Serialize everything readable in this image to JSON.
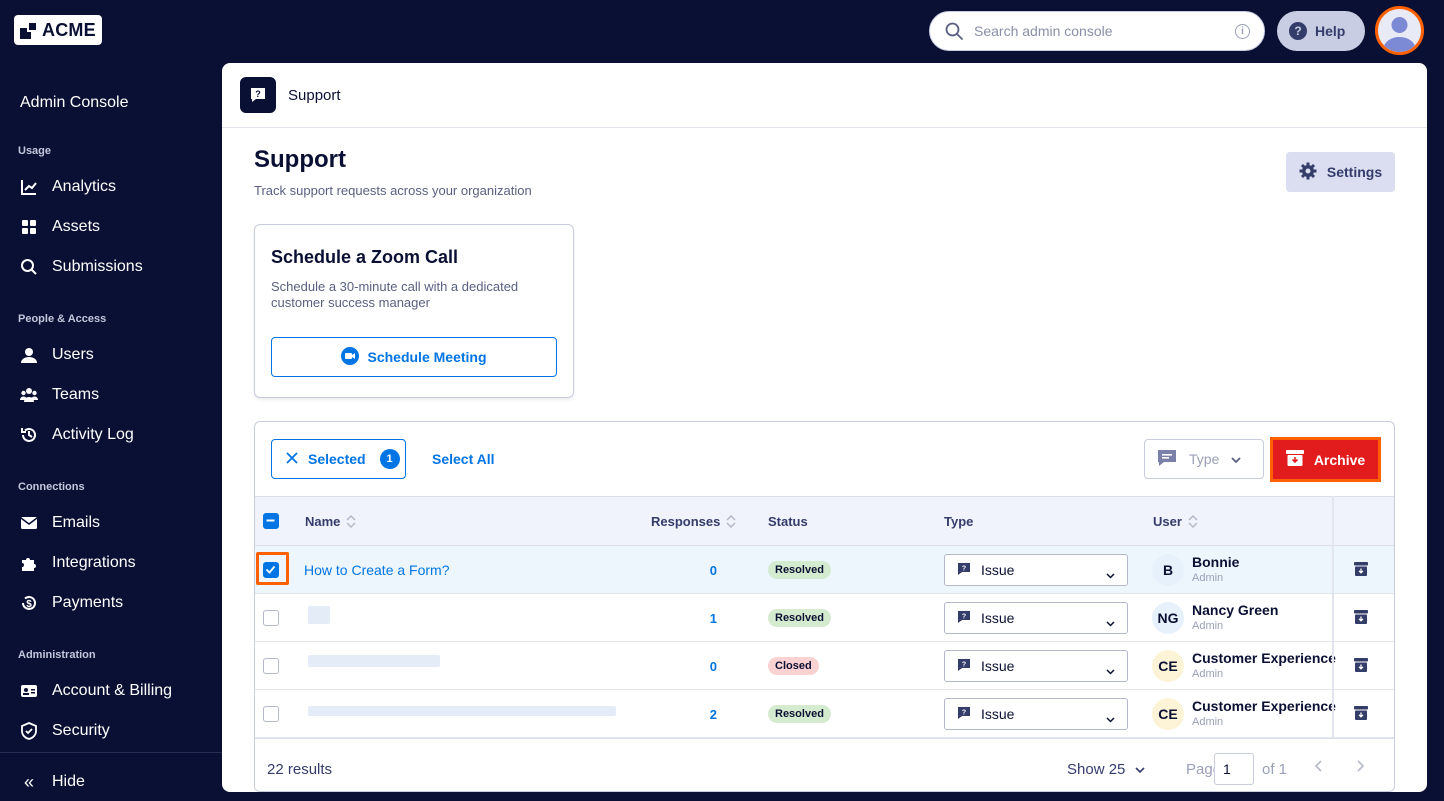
{
  "topbar": {
    "logo_text": "ACME",
    "search_placeholder": "Search admin console",
    "help_label": "Help"
  },
  "sidebar": {
    "title": "Admin Console",
    "sections": [
      {
        "label": "Usage",
        "items": [
          {
            "label": "Analytics",
            "icon": "chart-line-icon"
          },
          {
            "label": "Assets",
            "icon": "assets-grid-icon"
          },
          {
            "label": "Submissions",
            "icon": "search-icon"
          }
        ]
      },
      {
        "label": "People & Access",
        "items": [
          {
            "label": "Users",
            "icon": "user-icon"
          },
          {
            "label": "Teams",
            "icon": "team-icon"
          },
          {
            "label": "Activity Log",
            "icon": "history-icon"
          }
        ]
      },
      {
        "label": "Connections",
        "items": [
          {
            "label": "Emails",
            "icon": "envelope-icon"
          },
          {
            "label": "Integrations",
            "icon": "puzzle-icon"
          },
          {
            "label": "Payments",
            "icon": "dollar-icon"
          }
        ]
      },
      {
        "label": "Administration",
        "items": [
          {
            "label": "Account & Billing",
            "icon": "id-card-icon"
          },
          {
            "label": "Security",
            "icon": "shield-icon"
          }
        ]
      }
    ],
    "hide_label": "Hide"
  },
  "main": {
    "header_title": "Support",
    "page_title": "Support",
    "page_subtitle": "Track support requests across your organization",
    "settings_label": "Settings",
    "zoom_card": {
      "title": "Schedule a Zoom Call",
      "description": "Schedule a 30-minute call with a dedicated customer success manager",
      "button_label": "Schedule Meeting"
    }
  },
  "table": {
    "toolbar": {
      "selected_label": "Selected",
      "selected_count": "1",
      "select_all_label": "Select All",
      "type_filter_placeholder": "Type",
      "archive_label": "Archive"
    },
    "columns": [
      "Name",
      "Responses",
      "Status",
      "Type",
      "User"
    ],
    "rows": [
      {
        "name": "How to Create a Form?",
        "responses": "0",
        "status": "Resolved",
        "status_kind": "resolved",
        "type": "Issue",
        "user_initials": "B",
        "user_name": "Bonnie",
        "user_role": "Admin",
        "avatar_color": "#e6f1fb",
        "selected": true
      },
      {
        "name": "",
        "responses": "1",
        "status": "Resolved",
        "status_kind": "resolved",
        "type": "Issue",
        "user_initials": "NG",
        "user_name": "Nancy Green",
        "user_role": "Admin",
        "avatar_color": "#e6f1fb",
        "selected": false
      },
      {
        "name": "",
        "responses": "0",
        "status": "Closed",
        "status_kind": "closed",
        "type": "Issue",
        "user_initials": "CE",
        "user_name": "Customer Experience",
        "user_role": "Admin",
        "avatar_color": "#fdf3d6",
        "selected": false
      },
      {
        "name": "",
        "responses": "2",
        "status": "Resolved",
        "status_kind": "resolved",
        "type": "Issue",
        "user_initials": "CE",
        "user_name": "Customer Experience",
        "user_role": "Admin",
        "avatar_color": "#fdf3d6",
        "selected": false
      }
    ],
    "footer": {
      "results": "22 results",
      "show": "Show 25",
      "page_label": "Page",
      "page_value": "1",
      "of_label": "of 1"
    }
  },
  "colors": {
    "navy": "#0a1033",
    "accent_blue": "#0075e3",
    "archive_red": "#e21c1c",
    "highlight_orange": "#ff6100"
  }
}
